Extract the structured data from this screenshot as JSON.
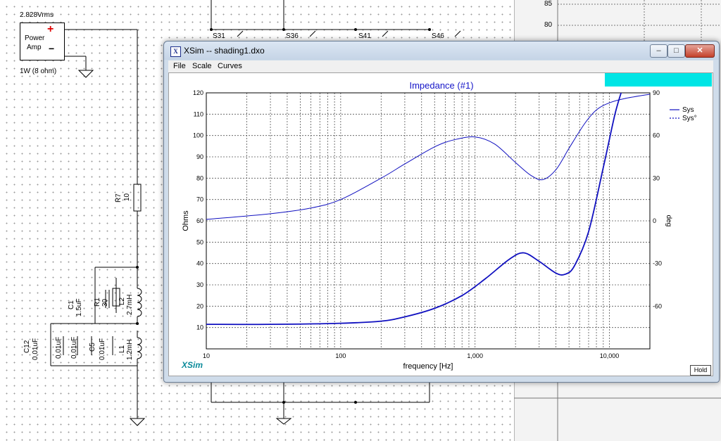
{
  "schematic": {
    "source_voltage": "2.828Vrms",
    "amp_label_1": "Power",
    "amp_label_2": "Amp",
    "amp_plus": "+",
    "amp_minus": "−",
    "amp_rating": "1W (8 ohm)",
    "switches": [
      "S31",
      "S36",
      "S41",
      "S46"
    ],
    "r7_name": "R7",
    "r7_value": "10",
    "c1_name": "C1",
    "c1_value": "1.5uF",
    "r1_name": "R1",
    "r1_value": "30",
    "l2_name": "L2",
    "l2_value": "2.7mH",
    "c12_name": "C12",
    "c12_value": "0.01uF",
    "c11_value": "0.01uF",
    "c10_value": "0.01uF",
    "c5_name": "C5",
    "c5_value": "0.01uF",
    "l1_name": "L1",
    "l1_value": "1.2mH"
  },
  "right_panel": {
    "axis_labels": [
      "85",
      "80"
    ]
  },
  "window": {
    "title": "XSim -- shading1.dxo",
    "icon": "xsim-app-icon",
    "min_glyph": "–",
    "max_glyph": "□",
    "close_glyph": "✕"
  },
  "menu": [
    "File",
    "Scale",
    "Curves"
  ],
  "plot": {
    "title": "Impedance (#1)",
    "logo": "XSim",
    "hold_label": "Hold",
    "legend": [
      {
        "name": "Sys",
        "style": "solid"
      },
      {
        "name": "Sys°",
        "style": "dashed"
      }
    ]
  },
  "chart_data": {
    "type": "line",
    "title": "Impedance (#1)",
    "xlabel": "frequency [Hz]",
    "ylabel": "Ohms",
    "y2label": "deg",
    "xscale": "log",
    "xlim": [
      10,
      20000
    ],
    "ylim": [
      0,
      120
    ],
    "y2lim": [
      -90,
      90
    ],
    "xticks": [
      10,
      100,
      1000,
      10000
    ],
    "xtick_labels": [
      "10",
      "100",
      "1,000",
      "10,000"
    ],
    "yticks": [
      10,
      20,
      30,
      40,
      50,
      60,
      70,
      80,
      90,
      100,
      110,
      120
    ],
    "y2ticks": [
      -60,
      -30,
      0,
      30,
      60,
      90
    ],
    "grid": true,
    "legend_position": "top-right",
    "line_color": "#1010c0",
    "series": [
      {
        "name": "Sys",
        "axis": "left",
        "x": [
          10,
          30,
          100,
          200,
          300,
          500,
          800,
          1200,
          1800,
          2300,
          3000,
          4000,
          4700,
          5500,
          7000,
          9000,
          11000,
          12500
        ],
        "values": [
          11.5,
          11.5,
          12,
          13,
          15,
          19,
          25,
          33,
          42,
          45,
          41,
          35.5,
          35,
          39,
          55,
          85,
          110,
          122
        ]
      },
      {
        "name": "Sys°",
        "axis": "right",
        "x": [
          10,
          30,
          60,
          100,
          200,
          300,
          500,
          700,
          1000,
          1400,
          2000,
          2600,
          3200,
          4000,
          5000,
          6500,
          8000,
          10000,
          13000,
          20000
        ],
        "values": [
          1,
          5,
          9,
          15,
          30,
          40,
          52,
          57,
          59,
          54,
          41,
          32,
          29,
          36,
          51,
          68,
          78,
          83,
          86,
          89
        ]
      }
    ]
  }
}
